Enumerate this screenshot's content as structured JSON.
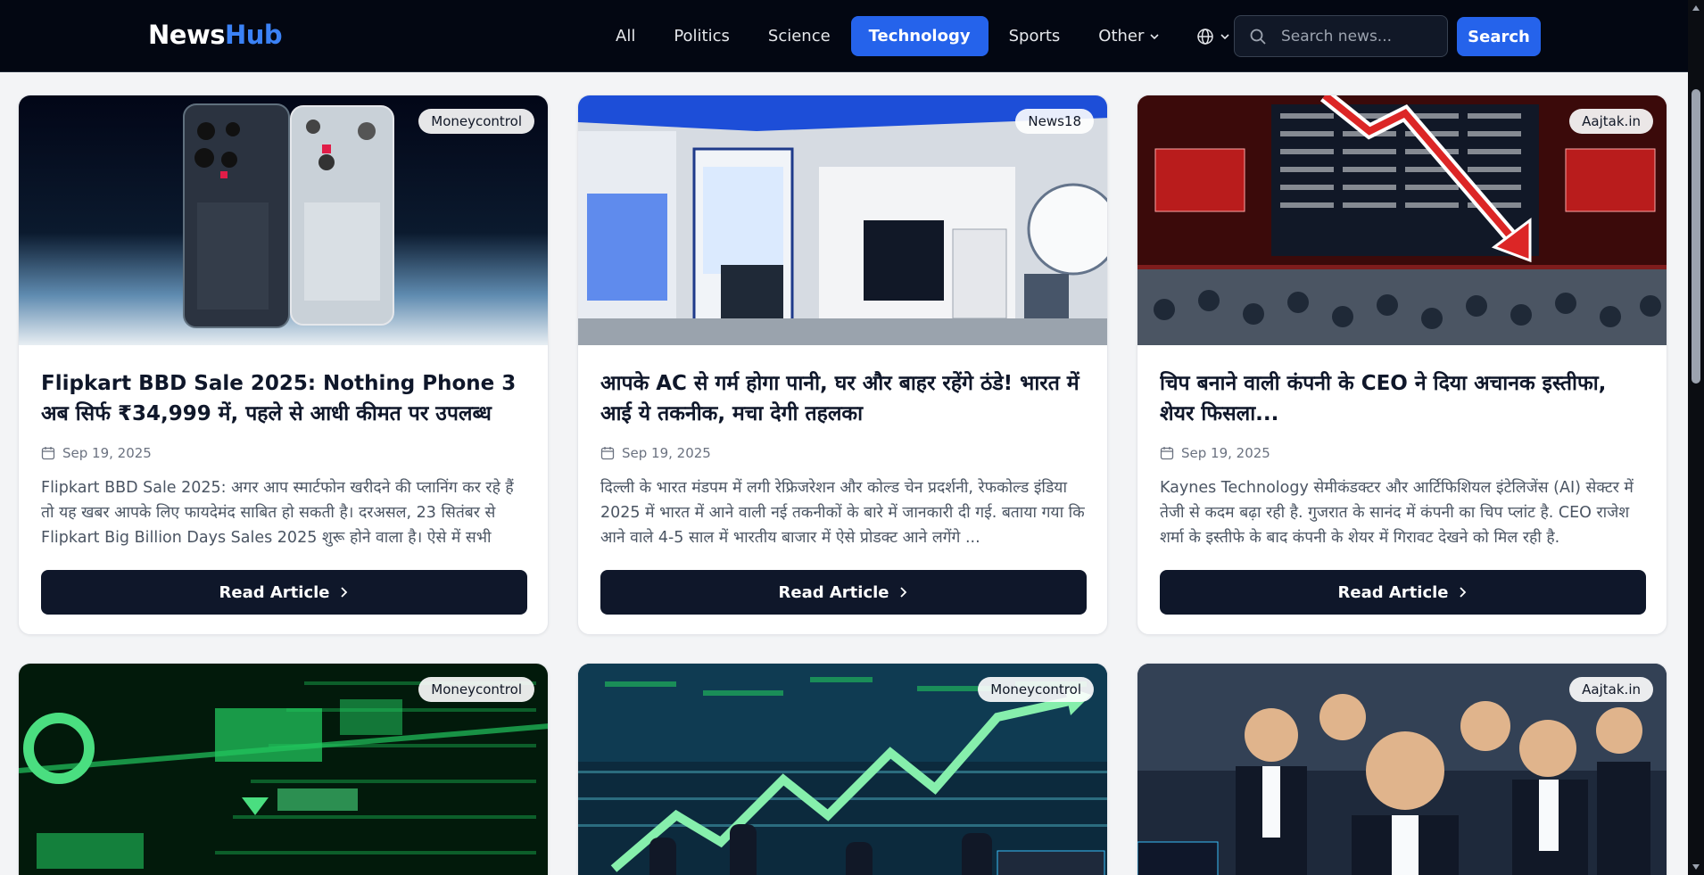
{
  "header": {
    "logo_part1": "News",
    "logo_part2": "Hub",
    "nav": [
      "All",
      "Politics",
      "Science",
      "Technology",
      "Sports",
      "Other"
    ],
    "active_nav": "Technology",
    "search_placeholder": "Search news...",
    "search_button": "Search"
  },
  "colors": {
    "header_bg": "#030712",
    "accent": "#2563eb",
    "button_dark": "#0f172a"
  },
  "articles": [
    {
      "source": "Moneycontrol",
      "title": "Flipkart BBD Sale 2025: Nothing Phone 3 अब सिर्फ ₹34,999 में, पहले से आधी कीमत पर उपलब्ध",
      "date": "Sep 19, 2025",
      "description": "Flipkart BBD Sale 2025: अगर आप स्मार्टफोन खरीदने की प्लानिंग कर रहे हैं तो यह खबर आपके लिए फायदेमंद साबित हो सकती है। दरअसल, 23 सितंबर से Flipkart Big Billion Days Sales 2025 शुरू होने वाला है। ऐसे में सभी स्मार्टफो...",
      "button": "Read Article",
      "image": "phones-image"
    },
    {
      "source": "News18",
      "title": "आपके AC से गर्म होगा पानी, घर और बाहर रहेंगे ठंडे! भारत में आई ये तकनीक, मचा देगी तहलका",
      "date": "Sep 19, 2025",
      "description": "दिल्ली के भारत मंडपम में लगी रेफ्रिजरेशन और कोल्ड चेन प्रदर्शनी, रेफकोल्ड इंडिया 2025 में भारत में आने वाली नई तकनीकों के बारे में जानकारी दी गई. बताया गया कि आने वाले 4-5 साल में भारतीय बाजार में ऐसे प्रोडक्ट आने लगेंगे ...",
      "button": "Read Article",
      "image": "expo-booth-image"
    },
    {
      "source": "Aajtak.in",
      "title": "चिप बनाने वाली कंपनी के CEO ने दिया अचानक इस्तीफा, शेयर फिसला...",
      "date": "Sep 19, 2025",
      "description": "Kaynes Technology सेमीकंडक्टर और आर्टिफिशियल इंटेलिजेंस (AI) सेक्टर में तेजी से कदम बढ़ा रही है. गुजरात के सानंद में कंपनी का चिप प्लांट है. CEO राजेश शर्मा के इस्तीफे के बाद कंपनी के शेयर में गिरावट देखने को मिल रही है.",
      "button": "Read Article",
      "image": "market-crash-image"
    },
    {
      "source": "Moneycontrol",
      "image": "green-ticker-image"
    },
    {
      "source": "Moneycontrol",
      "image": "trading-floor-image"
    },
    {
      "source": "Aajtak.in",
      "image": "celebrating-traders-image"
    }
  ]
}
